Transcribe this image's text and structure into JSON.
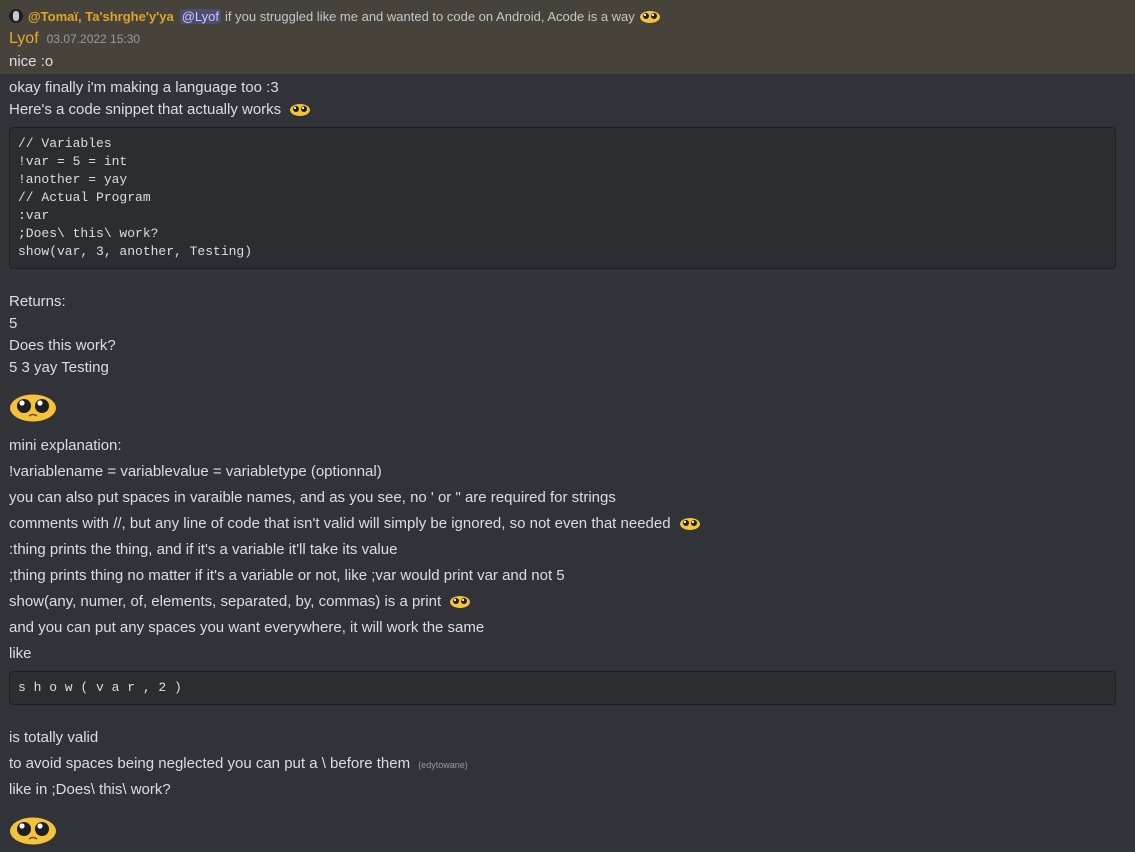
{
  "reply": {
    "author": "@Tomaï, Ta'shrghe'y'ya",
    "mention": "@Lyof",
    "text": "if you struggled like me and wanted to code on Android, Acode is a way"
  },
  "message": {
    "author": "Lyof",
    "timestamp": "03.07.2022 15:30",
    "lines": {
      "l1": "nice :o",
      "l2": "okay finally i'm making a language too :3",
      "l3": "Here's a code snippet that actually works",
      "returns_label": "Returns:",
      "r1": "5",
      "r2": "Does this work?",
      "r3": "5 3 yay Testing",
      "e1": "mini explanation:",
      "e2": "!variablename = variablevalue = variabletype (optionnal)",
      "e3": "you can also put spaces in varaible names, and as you see, no ' or \" are required for strings",
      "e4": "comments with //, but any line of code that isn't valid will simply be ignored, so not even that needed",
      "e5": ":thing prints the thing, and if it's a variable it'll take its value",
      "e6": ";thing prints thing no matter if it's a variable or not, like ;var would print var and not 5",
      "e7": "show(any, numer, of, elements, separated, by, commas) is a print",
      "e8": "and you can put any spaces you want everywhere, it will work the same",
      "e9": "like",
      "t1": "is totally valid",
      "t2": "to avoid spaces being neglected you can put a \\ before them",
      "t2_edited": "(edytowane)",
      "t3": "like in ;Does\\ this\\ work?"
    },
    "code1": [
      "// Variables",
      "!var = 5 = int",
      "!another = yay",
      "// Actual Program",
      ":var",
      ";Does\\ this\\ work?",
      "show(var, 3, another, Testing)"
    ],
    "code2": "s h o w ( v a r , 2 )"
  },
  "icons": {
    "reply_avatar": "avatar-icon",
    "emoji_small": "pleading-face-emoji",
    "emoji_big": "pleading-face-emoji"
  },
  "colors": {
    "background": "#313338",
    "highlight": "#48433a",
    "author": "#e5a82a",
    "mention_bg": "#5865f2"
  }
}
